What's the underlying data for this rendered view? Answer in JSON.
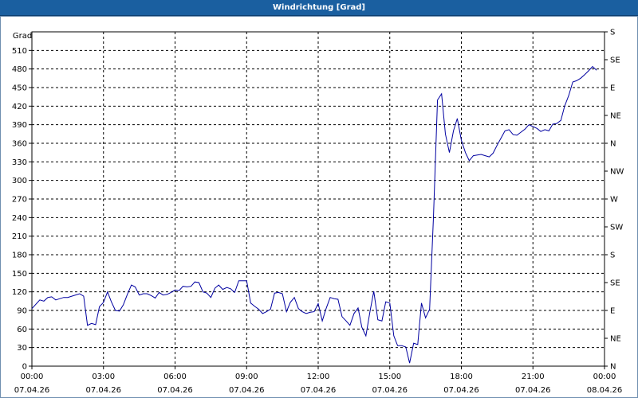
{
  "window": {
    "title": "Windrichtung [Grad]"
  },
  "colors": {
    "titlebar": "#1a5fa0",
    "line": "#0000a0",
    "grid": "#000000"
  },
  "chart_data": {
    "type": "line",
    "title": "Windrichtung [Grad]",
    "ylabel": "Grad",
    "xlabel": "",
    "ylim": [
      0,
      540
    ],
    "xlim": [
      0,
      24
    ],
    "grid": true,
    "legend": "none",
    "y_ticks": [
      0,
      30,
      60,
      90,
      120,
      150,
      180,
      210,
      240,
      270,
      300,
      330,
      360,
      390,
      420,
      450,
      480,
      510
    ],
    "right_ticks": [
      {
        "value": 0,
        "label": "N"
      },
      {
        "value": 45,
        "label": "NE"
      },
      {
        "value": 90,
        "label": "E"
      },
      {
        "value": 135,
        "label": "SE"
      },
      {
        "value": 180,
        "label": "S"
      },
      {
        "value": 225,
        "label": "SW"
      },
      {
        "value": 270,
        "label": "W"
      },
      {
        "value": 315,
        "label": "NW"
      },
      {
        "value": 360,
        "label": "N"
      },
      {
        "value": 405,
        "label": "NE"
      },
      {
        "value": 450,
        "label": "E"
      },
      {
        "value": 495,
        "label": "SE"
      },
      {
        "value": 540,
        "label": "S"
      }
    ],
    "x_ticks": [
      {
        "value": 0,
        "time": "00:00",
        "date": "07.04.26"
      },
      {
        "value": 3,
        "time": "03:00",
        "date": "07.04.26"
      },
      {
        "value": 6,
        "time": "06:00",
        "date": "07.04.26"
      },
      {
        "value": 9,
        "time": "09:00",
        "date": "07.04.26"
      },
      {
        "value": 12,
        "time": "12:00",
        "date": "07.04.26"
      },
      {
        "value": 15,
        "time": "15:00",
        "date": "07.04.26"
      },
      {
        "value": 18,
        "time": "18:00",
        "date": "07.04.26"
      },
      {
        "value": 21,
        "time": "21:00",
        "date": "07.04.26"
      },
      {
        "value": 24,
        "time": "00:00",
        "date": "08.04.26"
      }
    ],
    "series": [
      {
        "x": [
          0,
          0.33,
          0.5,
          0.67,
          0.83,
          1,
          1.17,
          1.33,
          1.5,
          1.67,
          1.83,
          2,
          2.17,
          2.33,
          2.5,
          2.67,
          2.83,
          3,
          3.17,
          3.33,
          3.5,
          3.67,
          3.83,
          4,
          4.17,
          4.33,
          4.5,
          4.67,
          4.83,
          5,
          5.17,
          5.33,
          5.5,
          5.67,
          5.83,
          6,
          6.17,
          6.33,
          6.5,
          6.67,
          6.83,
          7,
          7.17,
          7.33,
          7.5,
          7.67,
          7.83,
          8,
          8.17,
          8.33,
          8.5,
          8.67,
          8.83,
          9,
          9.17,
          9.33,
          9.5,
          9.67,
          9.83,
          10,
          10.17,
          10.33,
          10.5,
          10.67,
          10.83,
          11,
          11.17,
          11.33,
          11.5,
          11.67,
          11.83,
          12,
          12.17,
          12.33,
          12.5,
          12.67,
          12.83,
          13,
          13.17,
          13.33,
          13.5,
          13.67,
          13.83,
          14,
          14.17,
          14.33,
          14.5,
          14.67,
          14.83,
          15,
          15.17,
          15.33,
          15.5,
          15.67,
          15.83,
          16,
          16.17,
          16.33,
          16.5,
          16.67,
          16.83,
          17,
          17.17,
          17.33,
          17.5,
          17.67,
          17.83,
          18,
          18.17,
          18.33,
          18.5,
          18.67,
          18.83,
          19,
          19.17,
          19.33,
          19.5,
          19.67,
          19.83,
          20,
          20.17,
          20.33,
          20.5,
          20.67,
          20.83,
          21,
          21.17,
          21.33,
          21.5,
          21.67,
          21.83,
          22,
          22.17,
          22.33,
          22.5,
          22.67,
          22.83,
          23,
          23.17,
          23.33,
          23.5,
          23.67
        ],
        "values": [
          93,
          107,
          105,
          111,
          112,
          107,
          109,
          111,
          111,
          113,
          115,
          117,
          113,
          66,
          69,
          67,
          96,
          103,
          120,
          104,
          90,
          89,
          99,
          116,
          131,
          128,
          115,
          117,
          117,
          114,
          110,
          119,
          115,
          116,
          119,
          123,
          122,
          129,
          128,
          129,
          136,
          135,
          120,
          118,
          111,
          126,
          131,
          124,
          127,
          125,
          119,
          138,
          138,
          138,
          102,
          97,
          92,
          85,
          88,
          92,
          118,
          119,
          117,
          88,
          103,
          111,
          93,
          88,
          85,
          87,
          88,
          101,
          73,
          93,
          111,
          109,
          108,
          80,
          73,
          66,
          85,
          94,
          63,
          49,
          88,
          121,
          75,
          73,
          104,
          102,
          49,
          33,
          33,
          31,
          5,
          37,
          35,
          102,
          78,
          92,
          240,
          430,
          440,
          375,
          345,
          380,
          400,
          365,
          345,
          332,
          340,
          341,
          342,
          340,
          338,
          344,
          357,
          369,
          380,
          382,
          374,
          373,
          378,
          383,
          390,
          387,
          384,
          379,
          382,
          380,
          391,
          392,
          397,
          420,
          437,
          459,
          461,
          465,
          471,
          477,
          484,
          478
        ]
      }
    ]
  }
}
